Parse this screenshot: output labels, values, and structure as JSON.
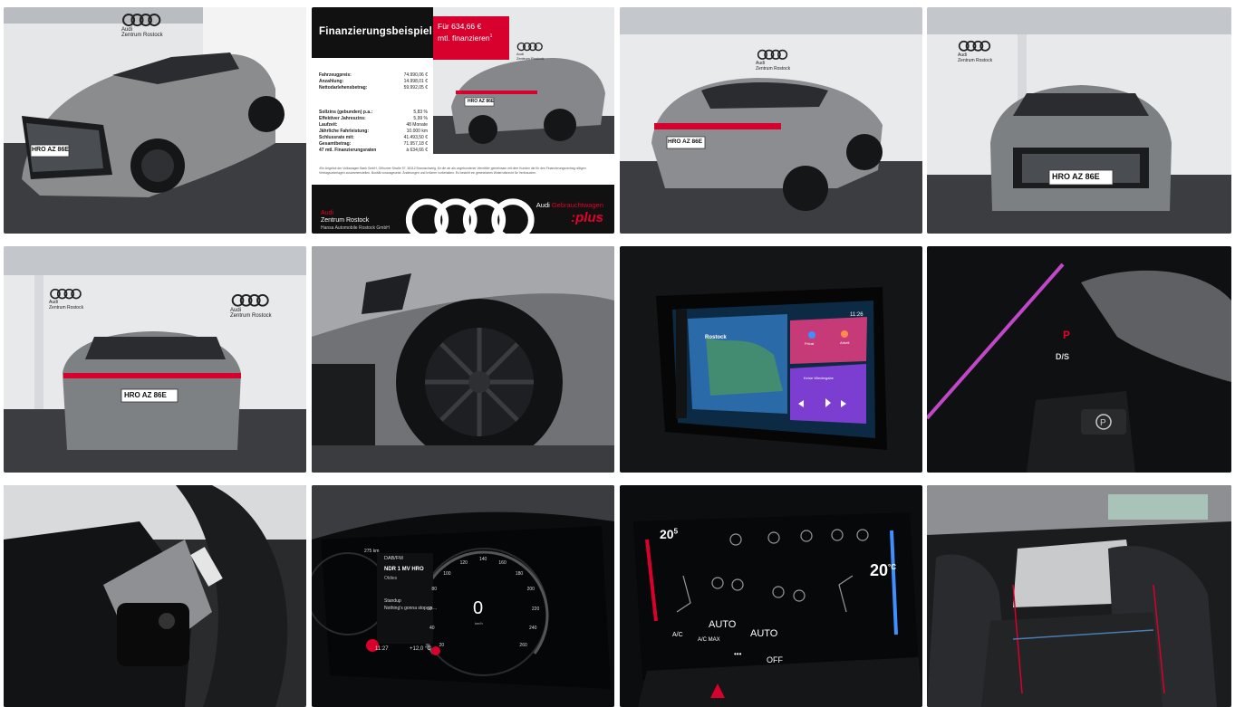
{
  "gallery": {
    "tile1": {
      "logo_line1": "Audi",
      "logo_line2": "Zentrum Rostock",
      "plate": "HRO AZ 86E"
    },
    "tile2": {
      "heading": "Finanzierungsbeispiel",
      "offer_line1": "Für 634,66 €",
      "offer_line2": "mtl. finanzieren",
      "offer_sup": "1",
      "logo_line1": "Audi",
      "logo_line2": "Zentrum Rostock",
      "rows": [
        {
          "label": "Fahrzeugpreis:",
          "value": "74.990,06 €"
        },
        {
          "label": "Anzahlung:",
          "value": "14.998,01 €"
        },
        {
          "label": "Nettodarlehensbetrag:",
          "value": "59.992,05 €"
        },
        {
          "label": "",
          "value": ""
        },
        {
          "label": "Sollzins (gebunden) p.a.:",
          "value": "5,83 %"
        },
        {
          "label": "Effektiver Jahreszins:",
          "value": "5,99 %"
        },
        {
          "label": "Laufzeit:",
          "value": "48 Monate"
        },
        {
          "label": "Jährliche Fahrleistung:",
          "value": "10.000 km"
        },
        {
          "label": "Schlussrate mit:",
          "value": "41.493,50 €"
        },
        {
          "label": "Gesamtbetrag:",
          "value": "71.957,18 €"
        },
        {
          "label": "47 mtl. Finanzierungsraten",
          "value": "à 634,66 €"
        }
      ],
      "footnote": "¹Ein Angebot der Volkswagen Bank GmbH, Gifhorner Straße 57, 38112 Braunschweig, für die wir als ungebundener Vermittler gemeinsam mit dem Kunden die für den Finanzierungsvertrag nötigen Vertragsunterlagen zusammenstellen. Bonität vorausgesetzt. Änderungen und Irrtümer vorbehalten. Es besteht ein gesetzliches Widerrufsrecht für Verbraucher.",
      "dealer_line1": "Audi",
      "dealer_line2": "Zentrum Rostock",
      "dealer_company": "Hansa Automobile Rostock GmbH",
      "program_brand": "Audi",
      "program_name": "Gebrauchtwagen",
      "program_plus": ":plus",
      "plate": "HRO AZ 86E"
    },
    "tile3": {
      "logo_line1": "Audi",
      "logo_line2": "Zentrum Rostock",
      "plate": "HRO AZ 86E"
    },
    "tile4": {
      "logo_line1": "Audi",
      "logo_line2": "Zentrum Rostock",
      "plate": "HRO AZ 86E"
    },
    "tile5": {
      "logo_line1": "Audi",
      "logo_line2": "Zentrum Rostock",
      "logo2_line1": "Audi",
      "logo2_line2": "Zentrum Rostock",
      "plate": "HRO AZ 86E"
    },
    "tile7": {
      "map_city": "Rostock",
      "time": "11:26",
      "home_label": "Privat",
      "work_label": "Arbeit",
      "media_label": "Keine Wiedergabe"
    },
    "tile8": {
      "gear": "D/S"
    },
    "tile10": {
      "station_band": "DAB/FM",
      "station_name": "NDR 1 MV HRO",
      "station_sub": "Oldies",
      "song_line1": "Standup",
      "song_line2": "Nothing's gonna stop us…",
      "range": "275 km",
      "time": "11:27",
      "temp": "+12,0 °C",
      "speed": "0",
      "speed_unit": "km/h",
      "ticks": [
        "20",
        "40",
        "60",
        "80",
        "100",
        "120",
        "140",
        "160",
        "180",
        "200",
        "220",
        "240",
        "260"
      ]
    },
    "tile11": {
      "temp_left": "20",
      "temp_right": "20",
      "temp_suffix": "5",
      "temp_unit": "°C",
      "auto_left": "AUTO",
      "auto_right": "AUTO",
      "ac": "A/C",
      "ac_max": "A/C MAX",
      "off": "OFF",
      "dots": "•••"
    }
  },
  "colors": {
    "audi_red": "#e4002b",
    "card_red": "#d8002c",
    "dark": "#111111",
    "car_grey": "#8a8c8e"
  }
}
